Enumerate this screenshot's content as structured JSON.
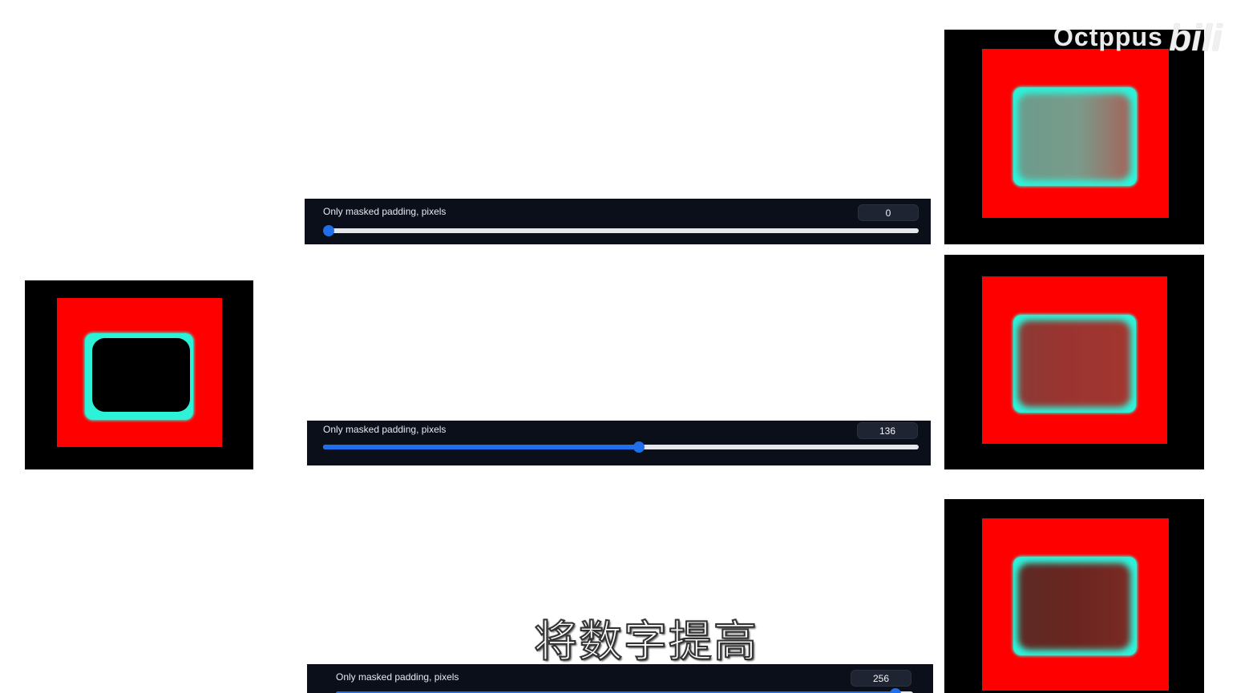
{
  "sliders": [
    {
      "label": "Only masked padding, pixels",
      "value": "0",
      "fraction": 0.0
    },
    {
      "label": "Only masked padding, pixels",
      "value": "136",
      "fraction": 0.53
    },
    {
      "label": "Only masked padding, pixels",
      "value": "256",
      "fraction": 0.97
    }
  ],
  "watermark": {
    "text": "Octppus",
    "brand": "bilibili"
  },
  "subtitle": "将数字提高",
  "colors": {
    "panel_bg": "#0b0f19",
    "slider_accent": "#1f6feb",
    "mask_red": "#ff0000",
    "mask_cyan": "#2ef2d8"
  }
}
